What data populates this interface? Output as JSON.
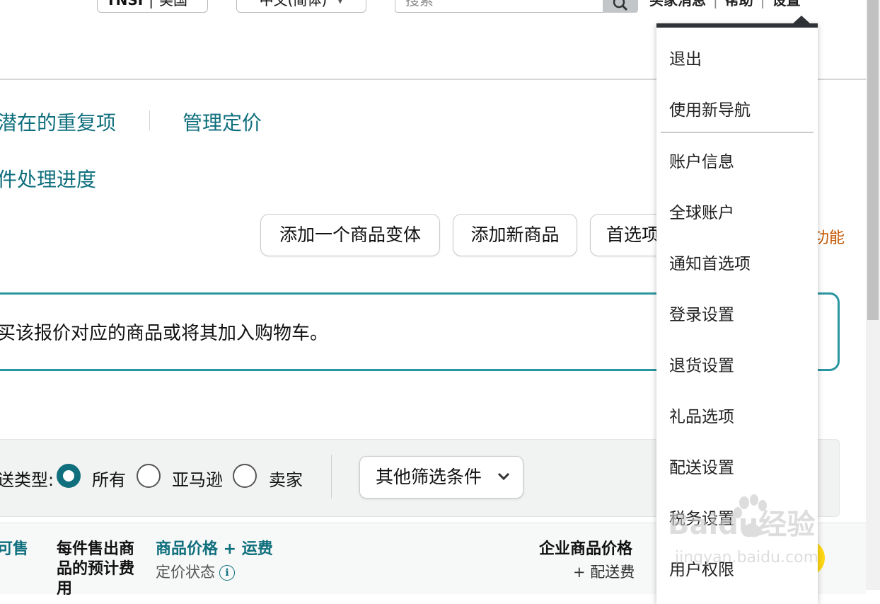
{
  "header": {
    "marketplace_code": "TNSI",
    "marketplace_name": "美国",
    "language": "中文(简体)",
    "search_placeholder": "搜索",
    "links": [
      "买家消息",
      "帮助",
      "设置"
    ]
  },
  "page_links": {
    "potential_duplicates": "潜在的重复项",
    "manage_pricing": "管理定价",
    "processing_progress": "件处理进度"
  },
  "actions": {
    "add_variation": "添加一个商品变体",
    "add_new_product": "添加新商品",
    "preferences": "首选项",
    "feature_link": "功能"
  },
  "alert": {
    "text": "买该报价对应的商品或将其加入购物车。"
  },
  "filters": {
    "fulfillment_label": "送类型:",
    "options": [
      "所有",
      "亚马逊",
      "卖家"
    ],
    "selected": "所有",
    "more_filters": "其他筛选条件"
  },
  "table_header": {
    "available": "可售",
    "fee_estimate": "每件售出商品的预计费用",
    "price_shipping": "商品价格 + 运费",
    "pricing_status": "定价状态",
    "business_price": "企业商品价格",
    "plus_shipping": "+ 配送费"
  },
  "settings_menu": {
    "items": [
      "退出",
      "使用新导航",
      "账户信息",
      "全球账户",
      "通知首选项",
      "登录设置",
      "退货设置",
      "礼品选项",
      "配送设置",
      "税务设置",
      "用户权限"
    ]
  },
  "watermark": {
    "brand": "Baidu经验",
    "url": "jingyan.baidu.com"
  },
  "colors": {
    "link": "#0f6f7d",
    "alert_border": "#2a96a0",
    "menu_bar": "#2f3337",
    "orange": "#c45500",
    "yellow": "#ffd814"
  }
}
